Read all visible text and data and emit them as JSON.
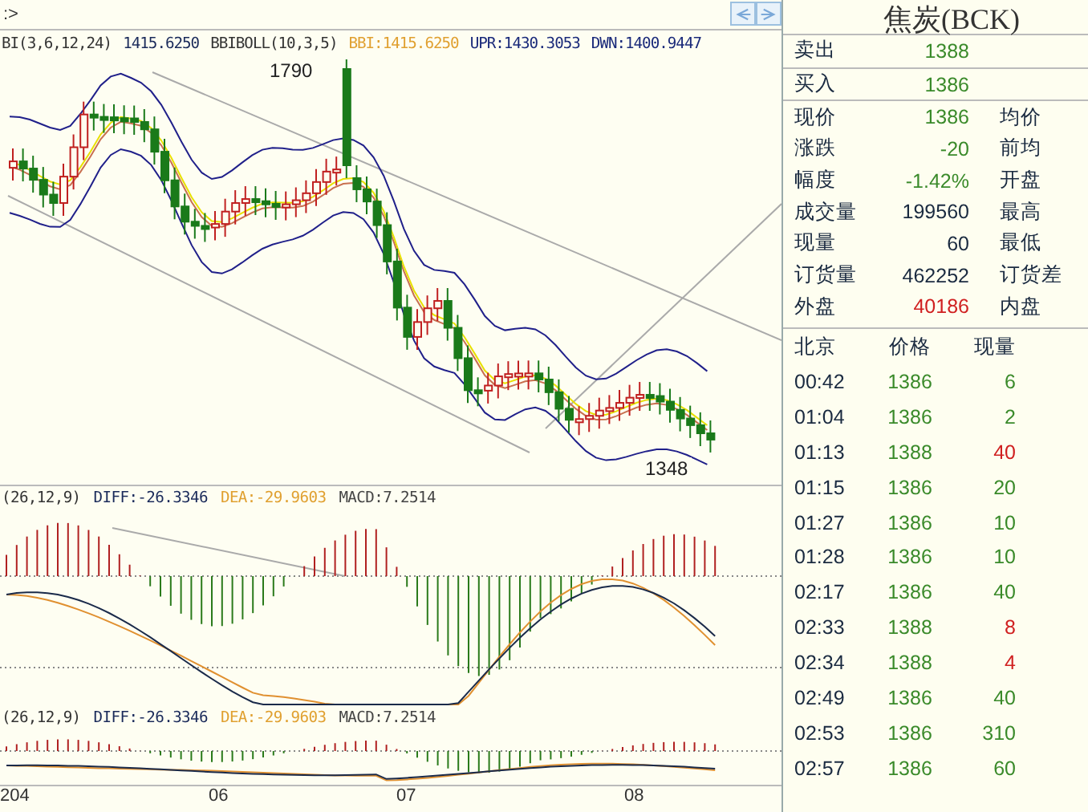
{
  "toolbar": {
    "prompt": ":>"
  },
  "main_chart": {
    "legend": [
      {
        "text": "BI(3,6,12,24)",
        "color": "#333333"
      },
      {
        "text": "1415.6250",
        "color": "#1a2a5a"
      },
      {
        "text": "BBIBOLL(10,3,5)",
        "color": "#333333"
      },
      {
        "text": "BBI:1415.6250",
        "color": "#e0a030"
      },
      {
        "text": "UPR:1430.3053",
        "color": "#1a2a7a"
      },
      {
        "text": "DWN:1400.9447",
        "color": "#1a2a7a"
      }
    ],
    "high_label": "1790",
    "low_label": "1348"
  },
  "indicator_panels": [
    {
      "legend": [
        {
          "text": "(26,12,9)",
          "color": "#333333"
        },
        {
          "text": "DIFF:-26.3346",
          "color": "#1a2a5a"
        },
        {
          "text": "DEA:-29.9603",
          "color": "#e0a030"
        },
        {
          "text": "MACD:7.2514",
          "color": "#444444"
        }
      ]
    },
    {
      "legend": [
        {
          "text": "(26,12,9)",
          "color": "#333333"
        },
        {
          "text": "DIFF:-26.3346",
          "color": "#1a2a5a"
        },
        {
          "text": "DEA:-29.9603",
          "color": "#e0a030"
        },
        {
          "text": "MACD:7.2514",
          "color": "#444444"
        }
      ]
    }
  ],
  "x_axis": [
    "204",
    "06",
    "07",
    "08"
  ],
  "quote": {
    "title": "焦炭(BCK)",
    "rows": [
      {
        "label": "卖出",
        "value": "1388",
        "color": "#3a8a2a",
        "boxed": true
      },
      {
        "label": "买入",
        "value": "1386",
        "color": "#3a8a2a",
        "boxed": true
      },
      {
        "label": "现价",
        "value": "1386",
        "color": "#3a8a2a",
        "label2": "均价"
      },
      {
        "label": "涨跌",
        "value": "-20",
        "color": "#3a8a2a",
        "label2": "前均"
      },
      {
        "label": "幅度",
        "value": "-1.42%",
        "color": "#3a8a2a",
        "label2": "开盘"
      },
      {
        "label": "成交量",
        "value": "199560",
        "color": "#1a2a40",
        "label2": "最高"
      },
      {
        "label": "现量",
        "value": "60",
        "color": "#1a2a40",
        "label2": "最低"
      },
      {
        "label": "订货量",
        "value": "462252",
        "color": "#1a2a40",
        "label2": "订货差"
      },
      {
        "label": "外盘",
        "value": "40186",
        "color": "#d02020",
        "label2": "内盘"
      }
    ]
  },
  "ticks": {
    "columns": [
      "北京",
      "价格",
      "现量"
    ],
    "rows": [
      {
        "time": "00:42",
        "price": "1386",
        "volume": "6",
        "color": "#3a8a2a"
      },
      {
        "time": "01:04",
        "price": "1386",
        "volume": "2",
        "color": "#3a8a2a"
      },
      {
        "time": "01:13",
        "price": "1388",
        "volume": "40",
        "color": "#d02020"
      },
      {
        "time": "01:15",
        "price": "1386",
        "volume": "20",
        "color": "#3a8a2a"
      },
      {
        "time": "01:27",
        "price": "1386",
        "volume": "10",
        "color": "#3a8a2a"
      },
      {
        "time": "01:28",
        "price": "1386",
        "volume": "10",
        "color": "#3a8a2a"
      },
      {
        "time": "02:17",
        "price": "1386",
        "volume": "40",
        "color": "#3a8a2a"
      },
      {
        "time": "02:33",
        "price": "1388",
        "volume": "8",
        "color": "#d02020"
      },
      {
        "time": "02:34",
        "price": "1388",
        "volume": "4",
        "color": "#d02020"
      },
      {
        "time": "02:49",
        "price": "1386",
        "volume": "40",
        "color": "#3a8a2a"
      },
      {
        "time": "02:53",
        "price": "1386",
        "volume": "310",
        "color": "#3a8a2a"
      },
      {
        "time": "02:57",
        "price": "1386",
        "volume": "60",
        "color": "#3a8a2a"
      }
    ]
  }
}
